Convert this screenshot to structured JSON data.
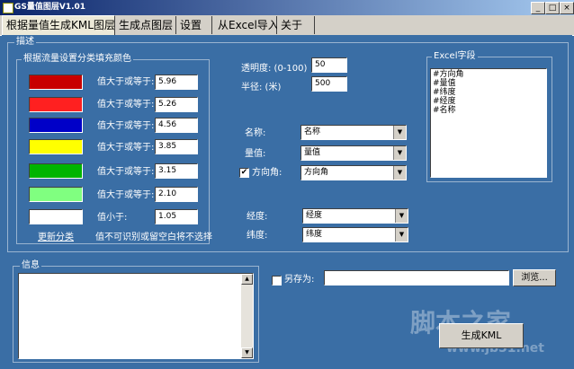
{
  "window": {
    "title": "GS量值图层V1.01",
    "minimize": "_",
    "maximize": "□",
    "close": "×"
  },
  "tabs": [
    {
      "label": "根据量值生成KML图层",
      "active": true
    },
    {
      "label": "生成点图层"
    },
    {
      "label": "设置"
    },
    {
      "label": "从Excel导入"
    },
    {
      "label": "关于"
    }
  ],
  "describe_group": {
    "legend": "描述"
  },
  "color_group": {
    "legend": "根据流量设置分类填充颜色",
    "rows": [
      {
        "color": "#c80000",
        "label": "值大于或等于:",
        "value": "5.96"
      },
      {
        "color": "#ff2020",
        "label": "值大于或等于:",
        "value": "5.26"
      },
      {
        "color": "#0000c8",
        "label": "值大于或等于:",
        "value": "4.56"
      },
      {
        "color": "#ffff00",
        "label": "值大于或等于:",
        "value": "3.85"
      },
      {
        "color": "#00b400",
        "label": "值大于或等于:",
        "value": "3.15"
      },
      {
        "color": "#80ff80",
        "label": "值大于或等于:",
        "value": "2.10"
      },
      {
        "color": "#ffffff",
        "label": "值小于:",
        "value": "1.05"
      }
    ],
    "refresh_link": "更新分类",
    "note": "值不可识别或留空白将不选择"
  },
  "opacity": {
    "label": "透明度: (0-100)",
    "value": "50"
  },
  "radius": {
    "label": "半径: (米)",
    "value": "500"
  },
  "fields": {
    "name": {
      "label": "名称:",
      "value": "名称"
    },
    "amount": {
      "label": "量值:",
      "value": "量值"
    },
    "direction": {
      "label": "方向角:",
      "value": "方向角",
      "checked": true
    },
    "longitude": {
      "label": "经度:",
      "value": "经度"
    },
    "latitude": {
      "label": "纬度:",
      "value": "纬度"
    }
  },
  "excel_fields": {
    "legend": "Excel字段",
    "items": [
      "#方向角",
      "#量值",
      "#纬度",
      "#经度",
      "#名称"
    ]
  },
  "info": {
    "legend": "信息"
  },
  "save_as": {
    "label": "另存为:",
    "checked": false,
    "value": ""
  },
  "browse_button": "浏览...",
  "generate_button": "生成KML",
  "watermark": {
    "line1": "脚本之家",
    "line2": "www.jb51.net"
  },
  "colors": {
    "background": "#3a6ea5",
    "titlebar_start": "#0a246a",
    "titlebar_end": "#a6caf0",
    "face": "#d4d0c8"
  }
}
